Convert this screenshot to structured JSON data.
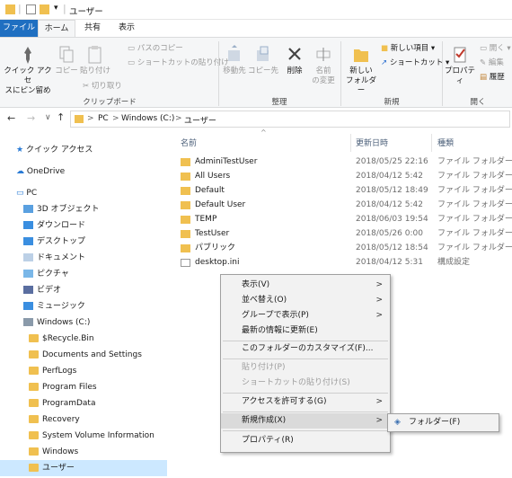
{
  "window": {
    "title": "ユーザー",
    "quick_access_dropdown": "▾"
  },
  "tabs": [
    "ファイル",
    "ホーム",
    "共有",
    "表示"
  ],
  "ribbon": {
    "clipboard": {
      "pin": "クイック アクセ\nスにピン留め",
      "copy": "コピー",
      "paste": "貼り付け",
      "copy_path": "パスのコピー",
      "paste_shortcut": "ショートカットの貼り付け",
      "cut": "切り取り",
      "label": "クリップボード"
    },
    "organize": {
      "move_to": "移動先",
      "copy_to": "コピー先",
      "delete": "削除",
      "rename": "名前\nの変更",
      "label": "整理"
    },
    "new": {
      "new_folder": "新しい\nフォルダー",
      "new_item": "新しい項目 ▾",
      "easy_access": "ショートカット ▾",
      "label": "新規"
    },
    "open": {
      "properties": "プロパティ",
      "open": "開く ▾",
      "edit": "編集",
      "history": "履歴",
      "label": "開く"
    }
  },
  "address": {
    "crumbs": [
      "PC",
      "Windows (C:)",
      "ユーザー"
    ],
    "sep": ">"
  },
  "nav": {
    "quick_access": "クイック アクセス",
    "onedrive": "OneDrive",
    "pc": "PC",
    "items": [
      "3D オブジェクト",
      "ダウンロード",
      "デスクトップ",
      "ドキュメント",
      "ピクチャ",
      "ビデオ",
      "ミュージック"
    ],
    "drive": "Windows (C:)",
    "drive_items": [
      "$Recycle.Bin",
      "Documents and Settings",
      "PerfLogs",
      "Program Files",
      "ProgramData",
      "Recovery",
      "System Volume Information",
      "Windows",
      "ユーザー"
    ]
  },
  "columns": {
    "name": "名前",
    "date": "更新日時",
    "type": "種類"
  },
  "files": [
    {
      "name": "AdminiTestUser",
      "date": "2018/05/25 22:16",
      "type": "ファイル フォルダー"
    },
    {
      "name": "All Users",
      "date": "2018/04/12 5:42",
      "type": "ファイル フォルダー"
    },
    {
      "name": "Default",
      "date": "2018/05/12 18:49",
      "type": "ファイル フォルダー"
    },
    {
      "name": "Default User",
      "date": "2018/04/12 5:42",
      "type": "ファイル フォルダー"
    },
    {
      "name": "TEMP",
      "date": "2018/06/03 19:54",
      "type": "ファイル フォルダー"
    },
    {
      "name": "TestUser",
      "date": "2018/05/26 0:00",
      "type": "ファイル フォルダー"
    },
    {
      "name": "パブリック",
      "date": "2018/05/12 18:54",
      "type": "ファイル フォルダー"
    },
    {
      "name": "desktop.ini",
      "date": "2018/04/12 5:31",
      "type": "構成設定"
    }
  ],
  "context_menu": {
    "view": "表示(V)",
    "sort": "並べ替え(O)",
    "group": "グループで表示(P)",
    "refresh": "最新の情報に更新(E)",
    "customize": "このフォルダーのカスタマイズ(F)...",
    "paste": "貼り付け(P)",
    "paste_shortcut": "ショートカットの貼り付け(S)",
    "give_access": "アクセスを許可する(G)",
    "new": "新規作成(X)",
    "properties": "プロパティ(R)",
    "arrow": ">"
  },
  "submenu": {
    "folder": "フォルダー(F)"
  },
  "colors": {
    "accent": "#1f6fc1",
    "folder": "#f0c050",
    "selection": "#cce8ff"
  }
}
